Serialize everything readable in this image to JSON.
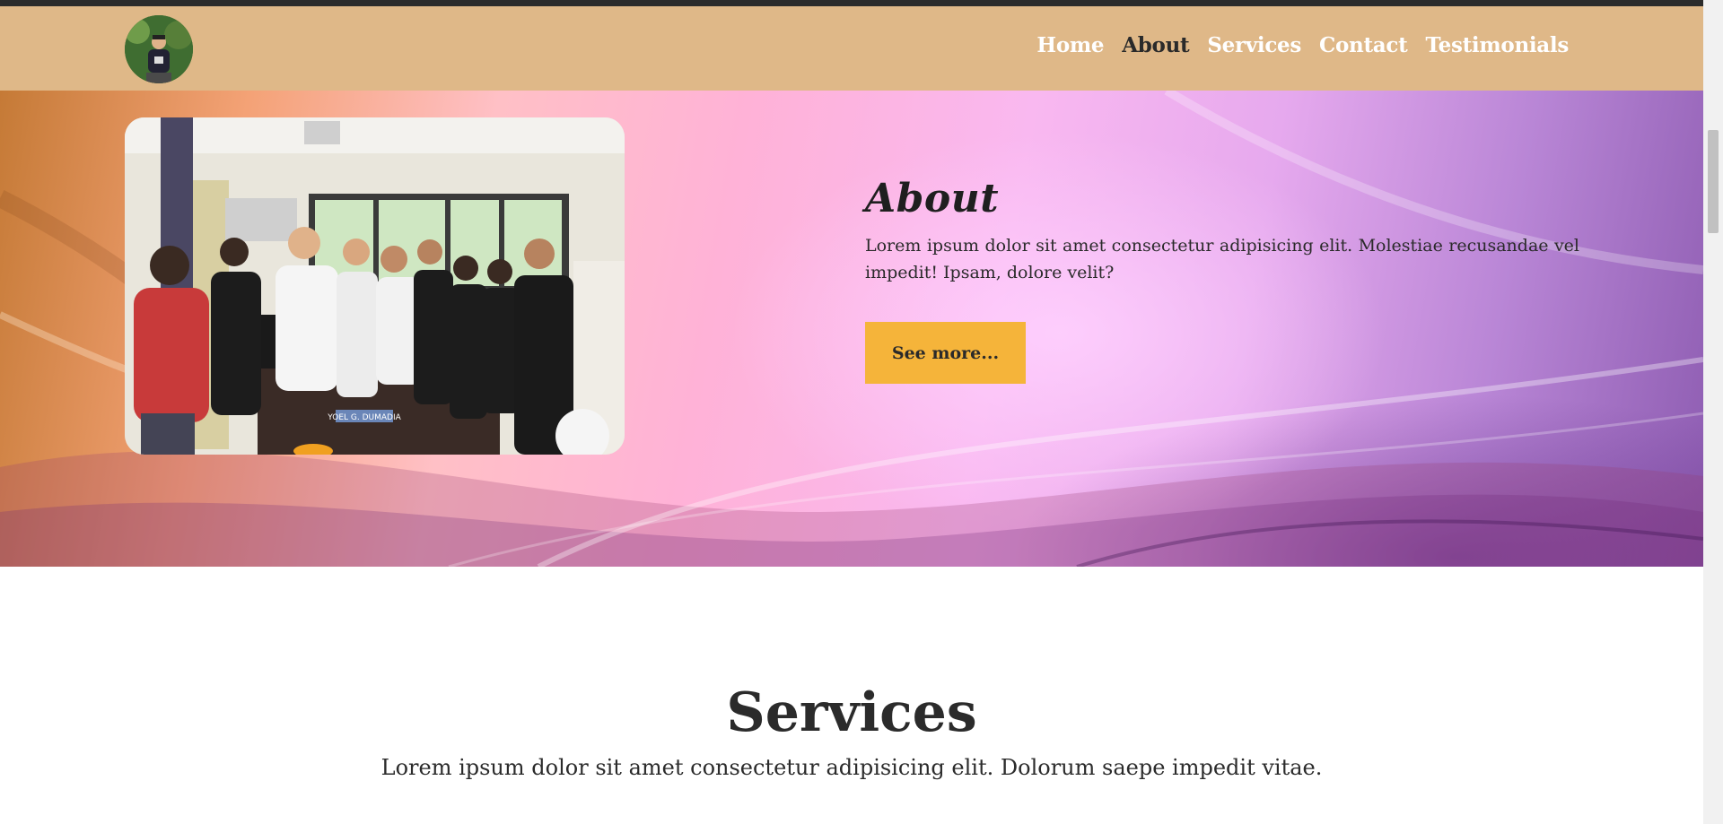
{
  "nav": {
    "items": [
      {
        "label": "Home",
        "active": false
      },
      {
        "label": "About",
        "active": true
      },
      {
        "label": "Services",
        "active": false
      },
      {
        "label": "Contact",
        "active": false
      },
      {
        "label": "Testimonials",
        "active": false
      }
    ]
  },
  "about": {
    "title": "About",
    "text": "Lorem ipsum dolor sit amet consectetur adipisicing elit. Molestiae recusandae vel impedit! Ipsam, dolore velit?",
    "button_label": "See more...",
    "photo_nameplate": "YOEL G. DUMADIA"
  },
  "services": {
    "title": "Services",
    "text": "Lorem ipsum dolor sit amet consectetur adipisicing elit. Dolorum saepe impedit vitae."
  },
  "colors": {
    "navbar": "#dfb888",
    "active_nav": "#2a2a2a",
    "button": "#f5b43a"
  }
}
